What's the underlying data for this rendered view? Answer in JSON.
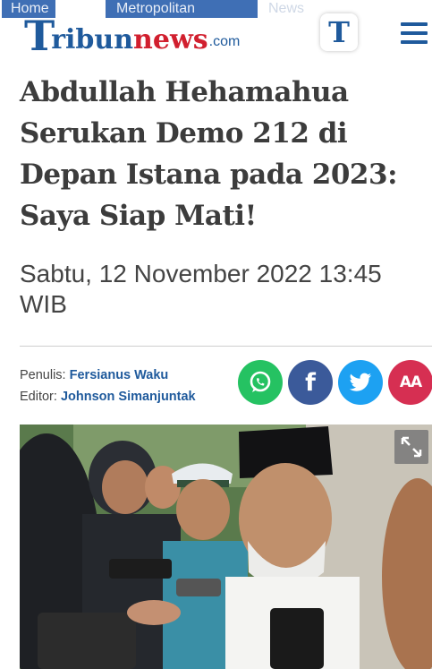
{
  "header": {
    "breadcrumb": [
      "Home",
      "Metropolitan",
      "News"
    ],
    "logo": {
      "t": "T",
      "ribun": "ribun",
      "news": "news",
      "com": ".com"
    },
    "app_icon_letter": "T"
  },
  "article": {
    "title": "Abdullah Hehamahua Serukan Demo 212 di Depan Istana pada 2023: Saya Siap Mati!",
    "date": "Sabtu, 12 November 2022 13:45 WIB",
    "writer_label": "Penulis:",
    "writer_name": "Fersianus Waku",
    "editor_label": "Editor:",
    "editor_name": "Johnson Simanjuntak"
  },
  "share": {
    "whatsapp_icon": "whatsapp-icon",
    "facebook_glyph": "f",
    "twitter_icon": "twitter-icon",
    "font_size_glyph": "AA"
  },
  "colors": {
    "brand_blue": "#1f5a9c",
    "brand_red": "#d11f2e",
    "whatsapp": "#25c262",
    "facebook": "#3b5a9a",
    "twitter": "#1da1f2",
    "font_button": "#d62f52"
  }
}
